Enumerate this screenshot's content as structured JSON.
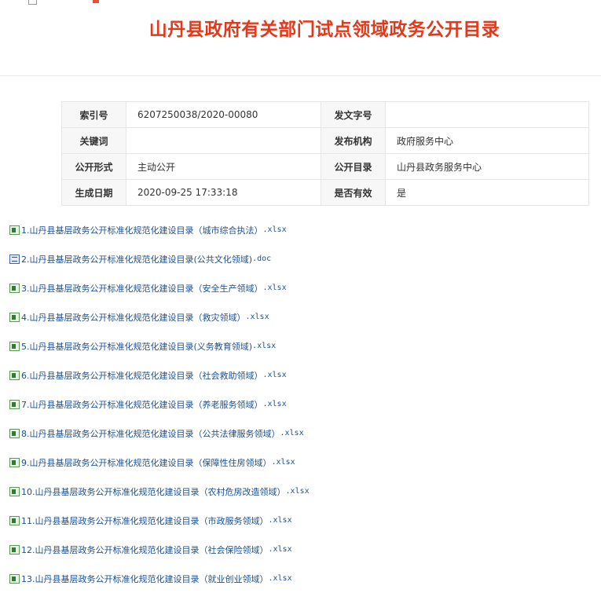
{
  "header": {
    "title": "山丹县政府有关部门试点领域政务公开目录"
  },
  "meta": {
    "rows": [
      {
        "k1": "索引号",
        "v1": "6207250038/2020-00080",
        "k2": "发文字号",
        "v2": ""
      },
      {
        "k1": "关键词",
        "v1": "",
        "k2": "发布机构",
        "v2": "政府服务中心"
      },
      {
        "k1": "公开形式",
        "v1": "主动公开",
        "k2": "公开目录",
        "v2": "山丹县政务服务中心"
      },
      {
        "k1": "生成日期",
        "v1": "2020-09-25 17:33:18",
        "k2": "是否有效",
        "v2": "是"
      }
    ]
  },
  "files": [
    {
      "name": "1.山丹县基层政务公开标准化规范化建设目录（城市综合执法）",
      "ext": ".xlsx",
      "icon": "excel-file-icon"
    },
    {
      "name": "2.山丹县基层政务公开标准化规范化建设目录(公共文化领域)",
      "ext": ".doc",
      "icon": "word-file-icon"
    },
    {
      "name": "3.山丹县基层政务公开标准化规范化建设目录（安全生产领域）",
      "ext": ".xlsx",
      "icon": "excel-file-icon"
    },
    {
      "name": "4.山丹县基层政务公开标准化规范化建设目录（救灾领域）",
      "ext": ".xlsx",
      "icon": "excel-file-icon"
    },
    {
      "name": "5.山丹县基层政务公开标准化规范化建设目录(义务教育领域)",
      "ext": ".xlsx",
      "icon": "excel-file-icon"
    },
    {
      "name": "6.山丹县基层政务公开标准化规范化建设目录（社会救助领域）",
      "ext": ".xlsx",
      "icon": "excel-file-icon"
    },
    {
      "name": "7.山丹县基层政务公开标准化规范化建设目录（养老服务领域）",
      "ext": ".xlsx",
      "icon": "excel-file-icon"
    },
    {
      "name": "8.山丹县基层政务公开标准化规范化建设目录（公共法律服务领域）",
      "ext": ".xlsx",
      "icon": "excel-file-icon"
    },
    {
      "name": "9.山丹县基层政务公开标准化规范化建设目录（保障性住房领域）",
      "ext": ".xlsx",
      "icon": "excel-file-icon"
    },
    {
      "name": "10.山丹县基层政务公开标准化规范化建设目录（农村危房改造领域）",
      "ext": ".xlsx",
      "icon": "excel-file-icon"
    },
    {
      "name": "11.山丹县基层政务公开标准化规范化建设目录（市政服务领域）",
      "ext": ".xlsx",
      "icon": "excel-file-icon"
    },
    {
      "name": "12.山丹县基层政务公开标准化规范化建设目录（社会保险领域）",
      "ext": ".xlsx",
      "icon": "excel-file-icon"
    },
    {
      "name": "13.山丹县基层政务公开标准化规范化建设目录（就业创业领域）",
      "ext": ".xlsx",
      "icon": "excel-file-icon"
    }
  ]
}
